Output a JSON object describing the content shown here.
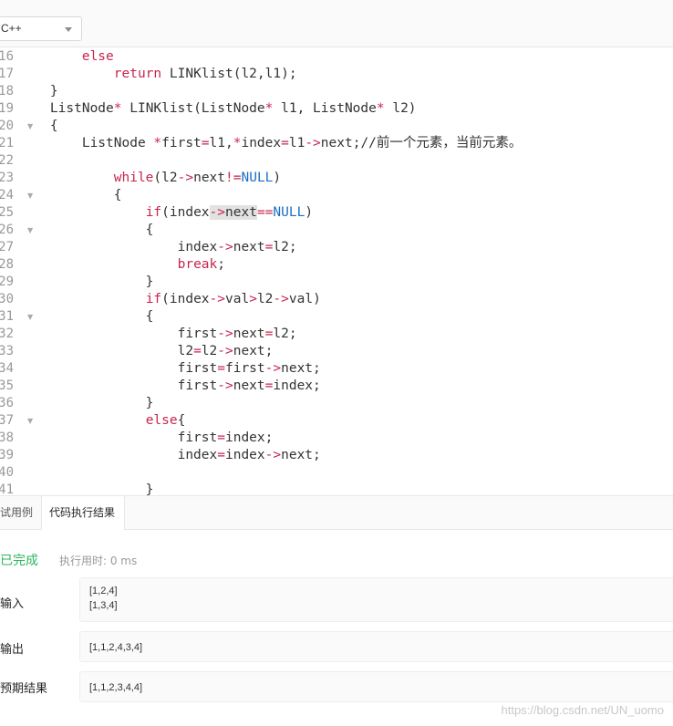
{
  "toolbar": {
    "language": "C++"
  },
  "editor": {
    "lines": [
      {
        "n": "16",
        "fold": false,
        "html": "        <span class=\"kw\">else</span>"
      },
      {
        "n": "17",
        "fold": false,
        "html": "            <span class=\"kw\">return</span> LINKlist(l2,l1);"
      },
      {
        "n": "18",
        "fold": false,
        "html": "    }"
      },
      {
        "n": "19",
        "fold": false,
        "html": "    ListNode<span class=\"op\">*</span> LINKlist(ListNode<span class=\"op\">*</span> l1, ListNode<span class=\"op\">*</span> l2)"
      },
      {
        "n": "20",
        "fold": true,
        "html": "    {"
      },
      {
        "n": "21",
        "fold": false,
        "html": "        ListNode <span class=\"op\">*</span>first<span class=\"op\">=</span>l1,<span class=\"op\">*</span>index<span class=\"op\">=</span>l1<span class=\"op\">-&gt;</span>next;//前一个元素，当前元素。"
      },
      {
        "n": "22",
        "fold": false,
        "html": ""
      },
      {
        "n": "23",
        "fold": false,
        "html": "            <span class=\"kw\">while</span>(l2<span class=\"op\">-&gt;</span>next<span class=\"op\">!=</span><span class=\"lit\">NULL</span>)"
      },
      {
        "n": "24",
        "fold": true,
        "html": "            {"
      },
      {
        "n": "25",
        "fold": false,
        "html": "                <span class=\"kw\">if</span>(index<span class=\"op hl\">-&gt;</span><span class=\"hl\">next</span><span class=\"op\">==</span><span class=\"lit\">NULL</span>)"
      },
      {
        "n": "26",
        "fold": true,
        "html": "                {"
      },
      {
        "n": "27",
        "fold": false,
        "html": "                    index<span class=\"op\">-&gt;</span>next<span class=\"op\">=</span>l2;"
      },
      {
        "n": "28",
        "fold": false,
        "html": "                    <span class=\"kw\">break</span>;"
      },
      {
        "n": "29",
        "fold": false,
        "html": "                }"
      },
      {
        "n": "30",
        "fold": false,
        "html": "                <span class=\"kw\">if</span>(index<span class=\"op\">-&gt;</span>val<span class=\"op\">&gt;</span>l2<span class=\"op\">-&gt;</span>val)"
      },
      {
        "n": "31",
        "fold": true,
        "html": "                {"
      },
      {
        "n": "32",
        "fold": false,
        "html": "                    first<span class=\"op\">-&gt;</span>next<span class=\"op\">=</span>l2;"
      },
      {
        "n": "33",
        "fold": false,
        "html": "                    l2<span class=\"op\">=</span>l2<span class=\"op\">-&gt;</span>next;"
      },
      {
        "n": "34",
        "fold": false,
        "html": "                    first<span class=\"op\">=</span>first<span class=\"op\">-&gt;</span>next;"
      },
      {
        "n": "35",
        "fold": false,
        "html": "                    first<span class=\"op\">-&gt;</span>next<span class=\"op\">=</span>index;"
      },
      {
        "n": "36",
        "fold": false,
        "html": "                }"
      },
      {
        "n": "37",
        "fold": true,
        "html": "                <span class=\"kw\">else</span>{"
      },
      {
        "n": "38",
        "fold": false,
        "html": "                    first<span class=\"op\">=</span>index;"
      },
      {
        "n": "39",
        "fold": false,
        "html": "                    index<span class=\"op\">=</span>index<span class=\"op\">-&gt;</span>next;"
      },
      {
        "n": "40",
        "fold": false,
        "html": ""
      },
      {
        "n": "41",
        "fold": false,
        "html": "                }"
      }
    ]
  },
  "results": {
    "tabs": [
      "试用例",
      "代码执行结果"
    ],
    "status": "已完成",
    "runtime": "执行用时: 0 ms",
    "input_label": "输入",
    "input_lines": [
      "[1,2,4]",
      "[1,3,4]"
    ],
    "output_label": "输出",
    "output": "[1,1,2,4,3,4]",
    "expected_label": "预期结果",
    "expected": "[1,1,2,3,4,4]"
  },
  "watermark": "https://blog.csdn.net/UN_uomo",
  "icons": {
    "dropdown": "chevron-down-icon",
    "fold": "fold-arrow-icon"
  }
}
